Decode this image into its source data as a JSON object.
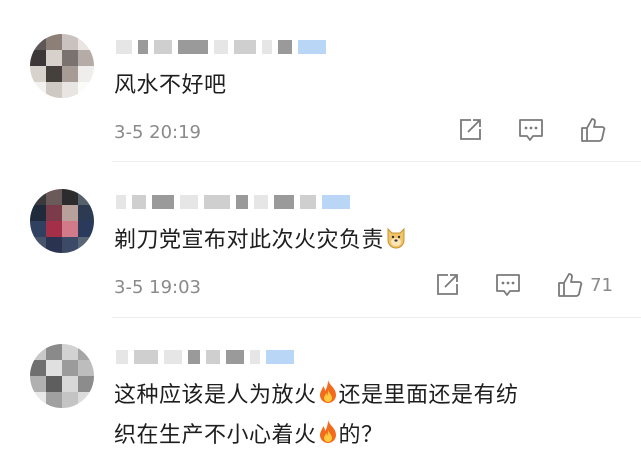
{
  "comments": [
    {
      "text": "风水不好吧",
      "time": "3-5 20:19",
      "like_count": ""
    },
    {
      "text": "剃刀党宣布对此次火灾负责",
      "time": "3-5 19:03",
      "like_count": "71"
    },
    {
      "text_line1": "这种应该是人为放火",
      "text_line1b": "还是里面还是有纺",
      "text_line2": "织在生产不小心着火",
      "text_line2b": "的？"
    }
  ],
  "icons": [
    "share-icon",
    "comment-icon",
    "like-icon",
    "fire-emoji",
    "doge-emoji"
  ],
  "colors": {
    "meta": "#8a8a8a",
    "divider": "#ededed",
    "badge": "#b9d6f7"
  }
}
